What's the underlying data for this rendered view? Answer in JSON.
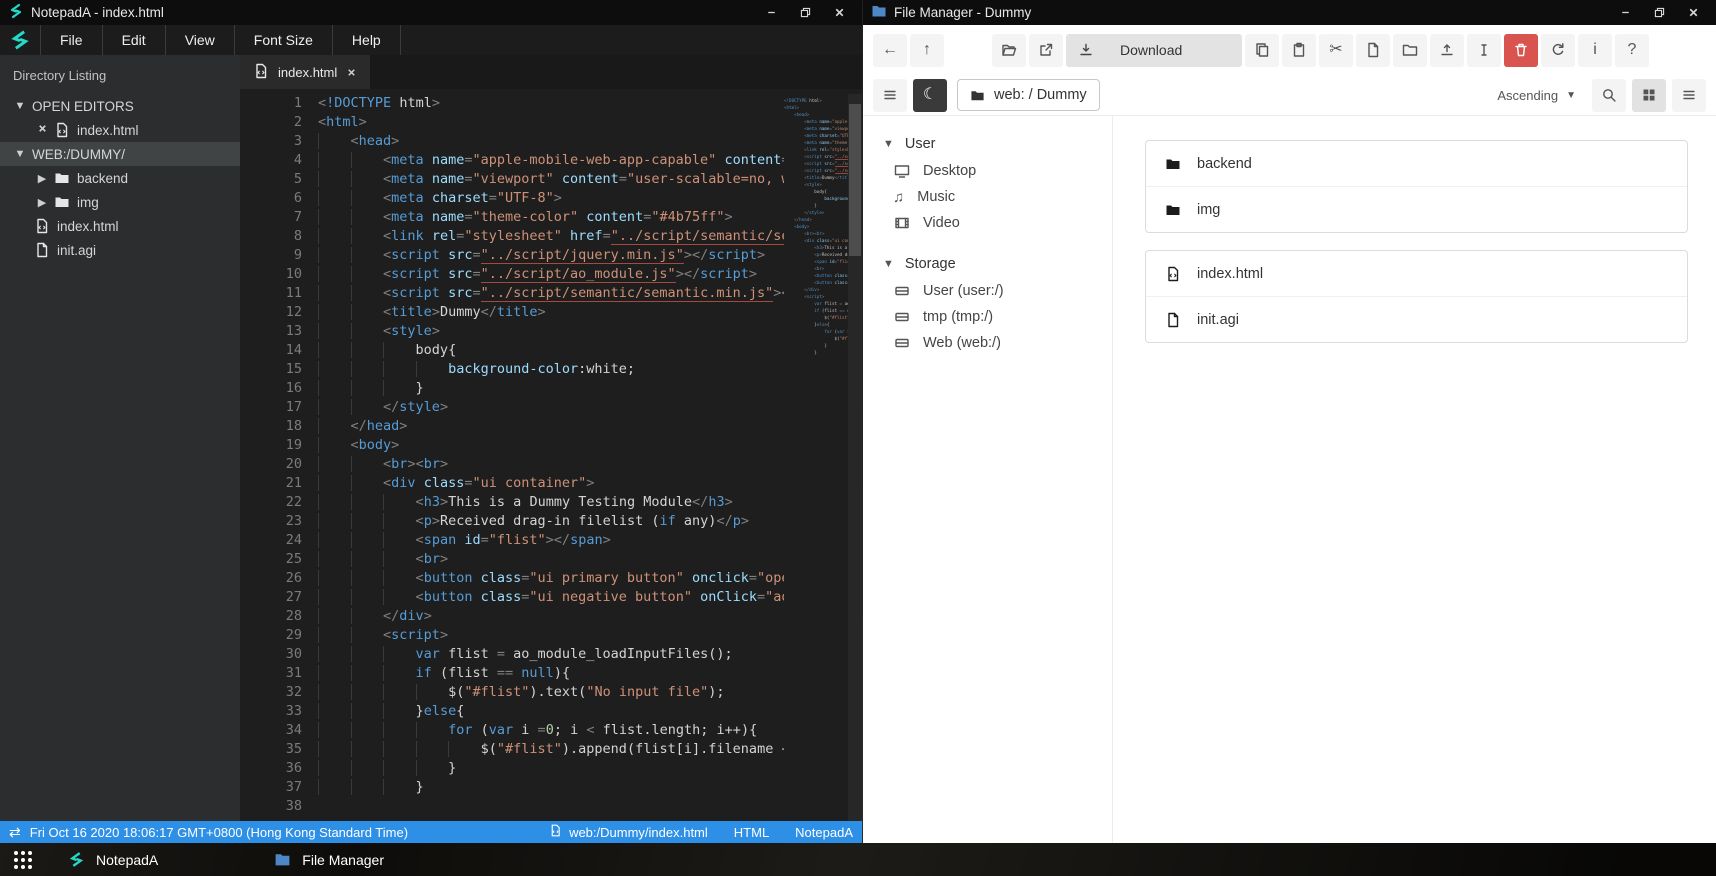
{
  "colors": {
    "accent_cyan": "#25d9c8",
    "statusbar_blue": "#2e8fe6",
    "delete_red": "#d9534f",
    "folder_blue": "#4a86c8",
    "editor_bg": "#1e1e1e",
    "sidebar_bg": "#2b2d2e",
    "tag_blue": "#569cd6",
    "string_orange": "#ce9178",
    "selection_gray": "#404445"
  },
  "notepada": {
    "title": "NotepadA - index.html",
    "menu": [
      {
        "label": "File"
      },
      {
        "label": "Edit"
      },
      {
        "label": "View"
      },
      {
        "label": "Font Size"
      },
      {
        "label": "Help"
      }
    ],
    "sidebar": {
      "header": "Directory Listing",
      "tree": [
        {
          "label": "OPEN EDITORS",
          "chev": "down",
          "lvl": 0
        },
        {
          "label": "index.html",
          "icon": "file-code",
          "close": true,
          "lvl": 1
        },
        {
          "label": "WEB:/DUMMY/",
          "chev": "down",
          "lvl": 0,
          "selected": true
        },
        {
          "label": "backend",
          "chev": "right",
          "icon": "folder-fill",
          "lvl": 1
        },
        {
          "label": "img",
          "chev": "right",
          "icon": "folder-fill",
          "lvl": 1
        },
        {
          "label": "index.html",
          "icon": "file-code",
          "lvl": 1
        },
        {
          "label": "init.agi",
          "icon": "file",
          "lvl": 1
        }
      ]
    },
    "tab": {
      "label": "index.html"
    },
    "editor": {
      "lines": [
        "<!DOCTYPE html>",
        "<html>",
        "    <head>",
        "        <meta name=\"apple-mobile-web-app-capable\" content=\"",
        "        <meta name=\"viewport\" content=\"user-scalable=no, wi",
        "        <meta charset=\"UTF-8\">",
        "        <meta name=\"theme-color\" content=\"#4b75ff\">",
        "        <link rel=\"stylesheet\" href=\"../script/semantic/sem",
        "        <script src=\"../script/jquery.min.js\"></script>",
        "        <script src=\"../script/ao_module.js\"></script>",
        "        <script src=\"../script/semantic/semantic.min.js\"></",
        "        <title>Dummy</title>",
        "        <style>",
        "            body{",
        "                background-color:white;",
        "            }",
        "        </style>",
        "    </head>",
        "    <body>",
        "        <br><br>",
        "        <div class=\"ui container\">",
        "            <h3>This is a Dummy Testing Module</h3>",
        "            <p>Received drag-in filelist (if any)</p>",
        "            <span id=\"flist\"></span>",
        "            <br>",
        "            <button class=\"ui primary button\" onclick=\"oper",
        "            <button class=\"ui negative button\" onClick=\"ao_",
        "        </div>",
        "        <script>",
        "            var flist = ao_module_loadInputFiles();",
        "            if (flist == null){",
        "                $(\"#flist\").text(\"No input file\");",
        "            }else{",
        "                for (var i =0; i < flist.length; i++){",
        "                    $(\"#flist\").append(flist[i].filename + ",
        "                }",
        "            }",
        ""
      ]
    },
    "statusbar": {
      "timestamp": "Fri Oct 16 2020 18:06:17 GMT+0800 (Hong Kong Standard Time)",
      "file": "web:/Dummy/index.html",
      "language": "HTML",
      "app": "NotepadA"
    }
  },
  "filemanager": {
    "title": "File Manager - Dummy",
    "toolbar": [
      {
        "name": "back-button",
        "icon": "arrow-left"
      },
      {
        "name": "up-button",
        "icon": "arrow-up"
      },
      {
        "name": "gap"
      },
      {
        "name": "open-button",
        "icon": "folder-open"
      },
      {
        "name": "open-in-new-window-button",
        "icon": "external-link"
      },
      {
        "name": "download-button",
        "icon": "download",
        "label": "Download",
        "variant": "wide"
      },
      {
        "name": "copy-button",
        "icon": "copy"
      },
      {
        "name": "paste-button",
        "icon": "paste"
      },
      {
        "name": "cut-button",
        "icon": "scissors"
      },
      {
        "name": "new-file-button",
        "icon": "file"
      },
      {
        "name": "new-folder-button",
        "icon": "folder"
      },
      {
        "name": "upload-button",
        "icon": "upload"
      },
      {
        "name": "rename-button",
        "icon": "text-cursor"
      },
      {
        "name": "delete-button",
        "icon": "trash",
        "variant": "danger"
      },
      {
        "name": "refresh-button",
        "icon": "refresh"
      },
      {
        "name": "info-button",
        "icon": "info"
      },
      {
        "name": "help-button",
        "icon": "help"
      }
    ],
    "toolbar2": {
      "breadcrumb": "web: / Dummy",
      "sort": "Ascending"
    },
    "sidebar": [
      {
        "label": "User",
        "items": [
          {
            "label": "Desktop",
            "icon": "monitor"
          },
          {
            "label": "Music",
            "icon": "music"
          },
          {
            "label": "Video",
            "icon": "film"
          }
        ]
      },
      {
        "label": "Storage",
        "items": [
          {
            "label": "User (user:/)",
            "icon": "drive"
          },
          {
            "label": "tmp (tmp:/)",
            "icon": "drive"
          },
          {
            "label": "Web (web:/)",
            "icon": "drive"
          }
        ]
      }
    ],
    "files": [
      {
        "rows": [
          {
            "name": "backend",
            "icon": "folder-fill"
          },
          {
            "name": "img",
            "icon": "folder-fill"
          }
        ]
      },
      {
        "rows": [
          {
            "name": "index.html",
            "icon": "file-code"
          },
          {
            "name": "init.agi",
            "icon": "file"
          }
        ]
      }
    ]
  },
  "taskbar": {
    "items": [
      {
        "label": "NotepadA",
        "icon": "notepada-logo"
      },
      {
        "label": "File Manager",
        "icon": "folder-blue"
      }
    ]
  }
}
